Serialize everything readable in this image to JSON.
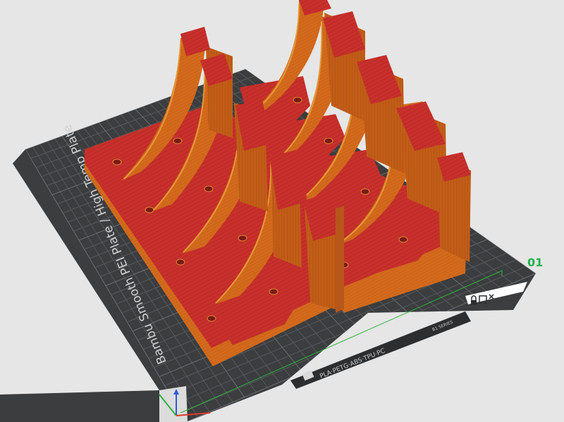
{
  "viewport": {
    "plate_number": "01",
    "plate_name": "Bambu Smooth PEI Plate / High Temp Plate",
    "plate_materials": "PLA·PETG·ABS·TPU·PC",
    "plate_code": "B1 SERIES"
  },
  "colors": {
    "background": "#e6e6e6",
    "bed": "#3b3d3f",
    "bed_grid": "#56595c",
    "bed_grid_major": "#6a6e71",
    "model_side": "#d36a1c",
    "model_side_dark": "#b8571a",
    "model_top": "#c8302c",
    "model_highlight": "#e9a640",
    "plate_number": "#22b14c",
    "axis_x": "#e0392b",
    "axis_y": "#2bb33a",
    "axis_z": "#2f59e0",
    "bound_line": "#2bb33a"
  },
  "icons": [
    "lock-icon",
    "edit-icon",
    "close-icon"
  ]
}
